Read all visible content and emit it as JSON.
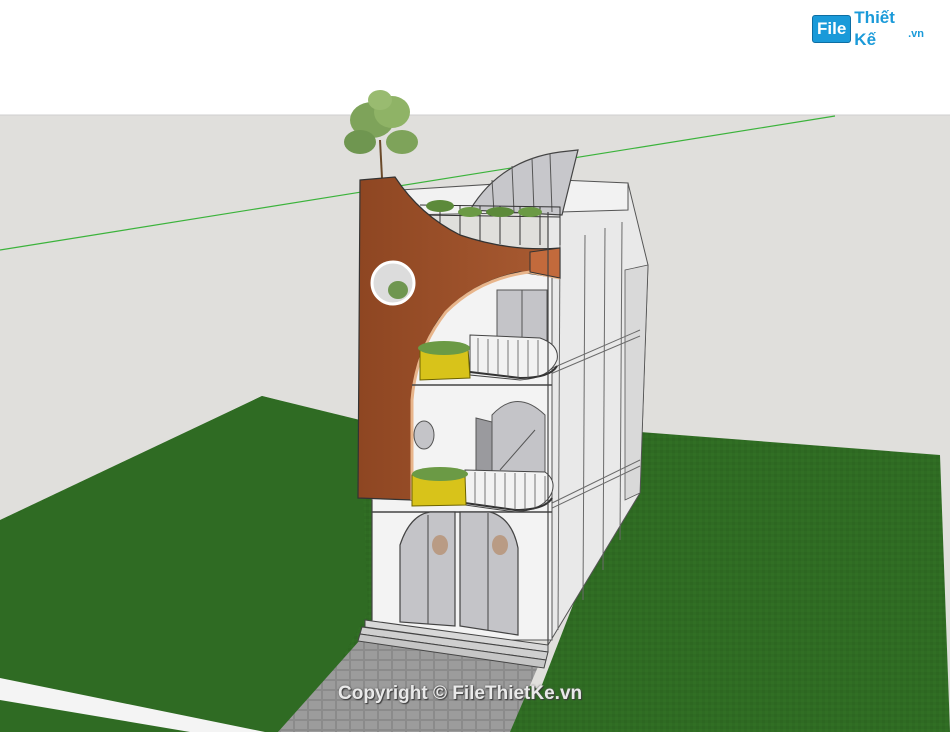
{
  "watermark": {
    "logo_box": "File",
    "logo_text": "Thiết Kế",
    "logo_suffix": ".vn"
  },
  "copyright": "Copyright © FileThietKe.vn",
  "colors": {
    "sky": "#ffffff",
    "horizon_ground": "#e0dfdc",
    "lawn": "#2f6b23",
    "facade_wood": "#a0522d",
    "wall": "#f2f2f2",
    "glass": "#b9b9bd",
    "planter": "#d8c31a",
    "axis_green": "#3bb33b",
    "logo_blue": "#1a9ad9"
  }
}
